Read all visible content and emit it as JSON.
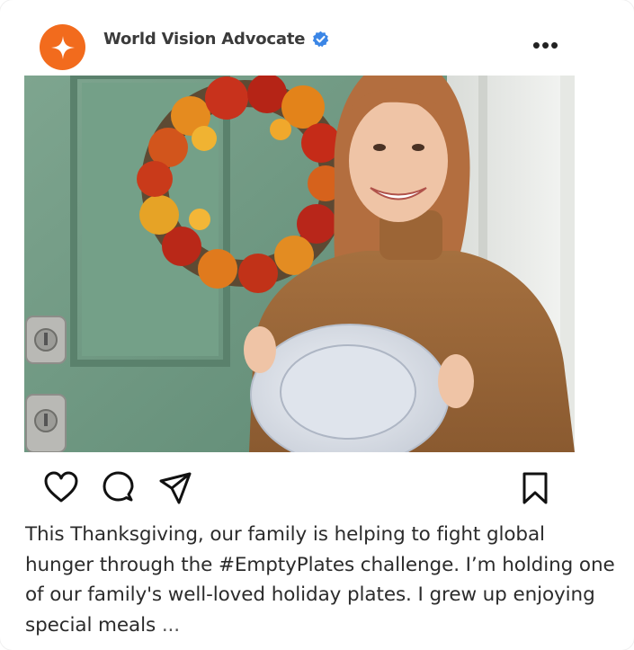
{
  "post": {
    "account_name": "World Vision Advocate",
    "verified": true,
    "avatar_icon": "sparkle-star-icon",
    "avatar_color": "#f26b1d",
    "verified_color": "#3b86e6",
    "more_label": "•••",
    "image_alt": "Woman in a brown sweater holding an empty white plate in front of a green door with an autumn wreath",
    "caption_text": "This Thanksgiving, our family is helping to fight global hunger through the #EmptyPlates challenge. I’m holding one of our family's well-loved holiday plates. I grew up enjoying special meals ",
    "caption_more": "...",
    "actions": [
      "heart-icon",
      "comment-icon",
      "share-icon",
      "bookmark-icon"
    ]
  }
}
